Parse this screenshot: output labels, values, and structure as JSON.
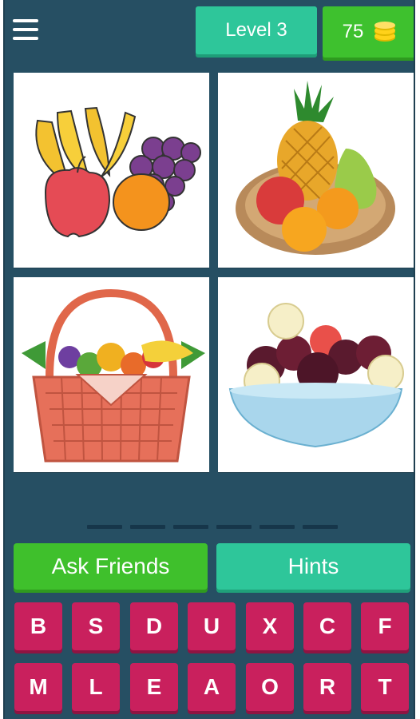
{
  "header": {
    "level_label": "Level 3",
    "coins": "75"
  },
  "tiles": [
    {
      "subject": "fruits-illustration"
    },
    {
      "subject": "fruit-plate-illustration"
    },
    {
      "subject": "fruit-basket-illustration"
    },
    {
      "subject": "fruit-bowl-illustration"
    }
  ],
  "answer": {
    "slot_count": 6
  },
  "actions": {
    "ask_friends_label": "Ask Friends",
    "hints_label": "Hints"
  },
  "keyboard": {
    "row1": [
      "B",
      "S",
      "D",
      "U",
      "X",
      "C",
      "F"
    ],
    "row2": [
      "M",
      "L",
      "E",
      "A",
      "O",
      "R",
      "T"
    ]
  },
  "colors": {
    "background": "#264f63",
    "green_button": "#3fc02c",
    "teal_button": "#2ec69a",
    "key": "#c9205d"
  }
}
